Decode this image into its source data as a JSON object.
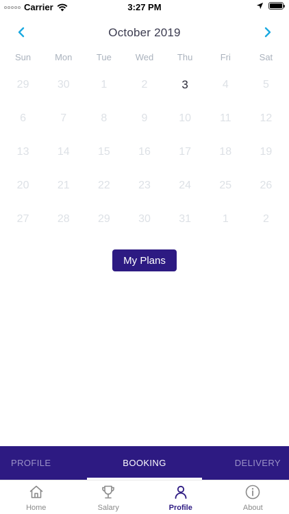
{
  "status_bar": {
    "carrier": "Carrier",
    "time": "3:27 PM"
  },
  "calendar": {
    "month_title": "October 2019",
    "weekdays": [
      "Sun",
      "Mon",
      "Tue",
      "Wed",
      "Thu",
      "Fri",
      "Sat"
    ],
    "weeks": [
      [
        "29",
        "30",
        "1",
        "2",
        "3",
        "4",
        "5"
      ],
      [
        "6",
        "7",
        "8",
        "9",
        "10",
        "11",
        "12"
      ],
      [
        "13",
        "14",
        "15",
        "16",
        "17",
        "18",
        "19"
      ],
      [
        "20",
        "21",
        "22",
        "23",
        "24",
        "25",
        "26"
      ],
      [
        "27",
        "28",
        "29",
        "30",
        "31",
        "1",
        "2"
      ]
    ],
    "selected_day": "3",
    "accent_color": "#1aa9e0"
  },
  "plans_button": {
    "label": "My Plans"
  },
  "segment_tabs": {
    "profile": "PROFILE",
    "booking": "BOOKING",
    "delivery": "DELIVERY",
    "active": "BOOKING"
  },
  "tab_bar": {
    "home": "Home",
    "salary": "Salary",
    "profile": "Profile",
    "about": "About",
    "active": "Profile"
  },
  "colors": {
    "brand": "#2d1a82",
    "muted_day": "#dde1e6",
    "weekday": "#aab2bd"
  }
}
